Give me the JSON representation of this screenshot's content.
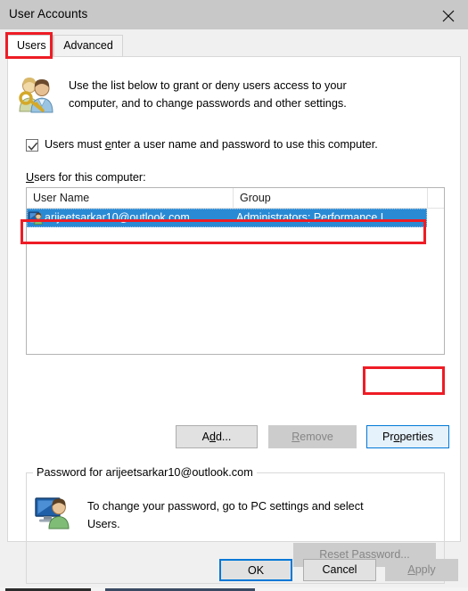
{
  "window": {
    "title": "User Accounts",
    "close_icon": "close-x-icon"
  },
  "tabs": [
    {
      "label": "Users",
      "active": true
    },
    {
      "label": "Advanced",
      "active": false
    }
  ],
  "header": {
    "icon": "users-with-key-icon",
    "line1": "Use the list below to grant or deny users access to your",
    "line2": "computer, and to change passwords and other settings."
  },
  "checkbox": {
    "label_pre": "Users must ",
    "label_mnemonic": "e",
    "label_post": "nter a user name and password to use this computer.",
    "checked": true,
    "check_icon": "checkmark-icon"
  },
  "list": {
    "label_mnemonic": "U",
    "label_post": "sers for this computer:",
    "columns": [
      "User Name",
      "Group"
    ],
    "rows": [
      {
        "icon": "user-monitor-icon",
        "user_name": "arijeetsarkar10@outlook.com",
        "group": "Administrators; Performance L...",
        "selected": true
      }
    ]
  },
  "actions": {
    "add": {
      "label_pre": "A",
      "label_mnemonic": "d",
      "label_post": "d...",
      "enabled": true
    },
    "remove": {
      "label_mnemonic": "R",
      "label_post": "emove",
      "enabled": false
    },
    "properties": {
      "label_pre": "Pr",
      "label_mnemonic": "o",
      "label_post": "perties",
      "enabled": true,
      "focused": true
    }
  },
  "password_group": {
    "title": "Password for arijeetsarkar10@outlook.com",
    "icon": "user-monitor-icon",
    "line1": "To change your password, go to PC settings and select",
    "line2": "Users.",
    "reset_button": {
      "label_pre": "Reset ",
      "label_mnemonic": "P",
      "label_post": "assword...",
      "enabled": false
    }
  },
  "footer": {
    "ok": {
      "label": "OK",
      "is_default": true,
      "enabled": true
    },
    "cancel": {
      "label": "Cancel",
      "enabled": true
    },
    "apply": {
      "label_mnemonic": "A",
      "label_post": "pply",
      "enabled": false
    }
  },
  "annotations": {
    "count": 3,
    "color": "#ee1c25",
    "targets": [
      "users-tab",
      "selected-user-row",
      "properties-button"
    ]
  },
  "colors": {
    "titlebar": "#c8c8c8",
    "dialog_bg": "#f0f0f0",
    "tabpage_bg": "#ffffff",
    "selection_blue": "#2a8ad4",
    "focus_blue": "#0078d7",
    "focus_fill": "#e5f1fb",
    "disabled_text": "#868686",
    "annotation_red": "#ee1c25"
  }
}
